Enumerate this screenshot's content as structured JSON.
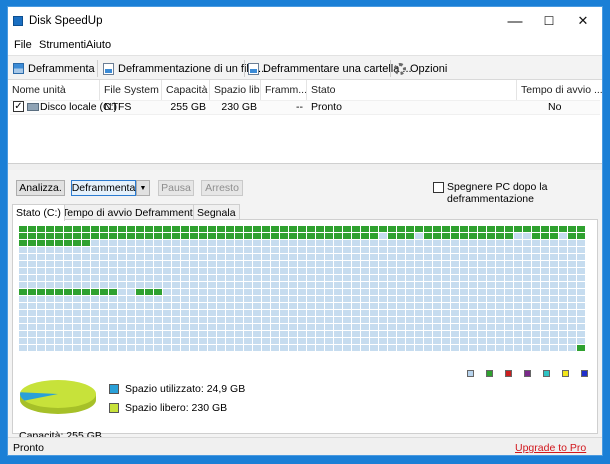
{
  "window": {
    "title": "Disk SpeedUp",
    "minimize": "—",
    "maximize": "☐",
    "close": "✕"
  },
  "menu": [
    "File",
    "Strumenti",
    "Aiuto"
  ],
  "toolbar": {
    "defrag": "Deframmenta",
    "defrag_file": "Deframmentazione di un file ...",
    "defrag_folder": "Deframmentare una cartella ...",
    "options": "Opzioni"
  },
  "drives": {
    "columns": [
      "Nome unità",
      "File System",
      "Capacità",
      "Spazio lib...",
      "Framm...",
      "Stato",
      "Tempo di avvio ..."
    ],
    "rows": [
      {
        "checked": true,
        "name": "Disco locale (C:)",
        "fs": "NTFS",
        "capacity": "255 GB",
        "free": "230 GB",
        "frag": "--",
        "status": "Pronto",
        "boot": "No"
      }
    ]
  },
  "actions": {
    "analyze": "Analizza.",
    "defrag": "Deframmenta",
    "pause": "Pausa",
    "stop": "Arresto",
    "shutdown_label": "Spegnere PC dopo la deframmentazione",
    "shutdown_checked": false
  },
  "tabs": [
    "Stato (C:)",
    "Tempo di avvio Deframmentazione",
    "Segnala"
  ],
  "disk_map": {
    "colors": {
      "used": "#2fa12f",
      "free": "#c6dcef"
    },
    "legend_colors": [
      "#b8d4ee",
      "#2fa12f",
      "#cc1f1f",
      "#7a2a8a",
      "#2fc4c4",
      "#f2e61a",
      "#1f2fcc"
    ]
  },
  "usage": {
    "used_label": "Spazio utilizzato: 24,9 GB",
    "free_label": "Spazio libero: 230 GB",
    "capacity_label": "Capacità: 255 GB",
    "used_color": "#2aa0d8",
    "free_color": "#c7e23a",
    "used_fraction": 0.098
  },
  "status": {
    "text": "Pronto",
    "upgrade": "Upgrade to Pro"
  }
}
